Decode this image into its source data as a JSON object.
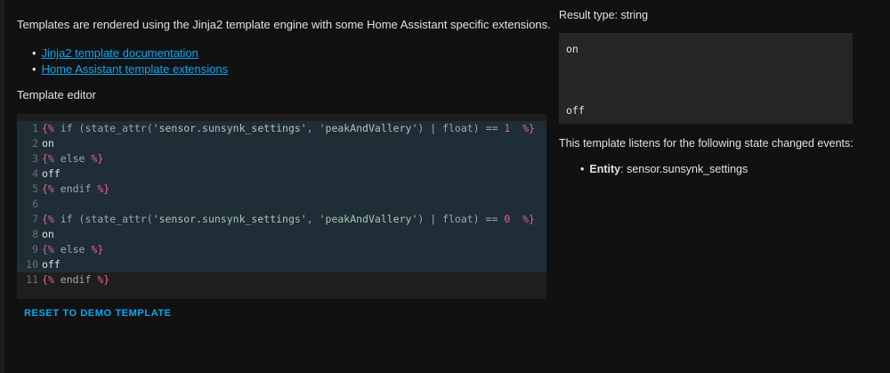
{
  "intro_text": "Templates are rendered using the Jinja2 template engine with some Home Assistant specific extensions.",
  "links": [
    "Jinja2 template documentation",
    "Home Assistant template extensions"
  ],
  "editor_label": "Template editor",
  "editor_lines": [
    "{% if (state_attr('sensor.sunsynk_settings', 'peakAndVallery') | float) == 1  %}",
    "on",
    "{% else %}",
    "off",
    "{% endif %}",
    "",
    "{% if (state_attr('sensor.sunsynk_settings', 'peakAndVallery') | float) == 0  %}",
    "on",
    "{% else %}",
    "off",
    "{% endif %}"
  ],
  "reset_button": "RESET TO DEMO TEMPLATE",
  "result_type": "Result type: string",
  "result_lines": [
    "on",
    "off"
  ],
  "listens_text": "This template listens for the following state changed events:",
  "entity_label": "Entity",
  "entity_value": ": sensor.sunsynk_settings",
  "colors": {
    "link": "#03a9f4",
    "tag": "#e0658c",
    "background": "#111111"
  }
}
